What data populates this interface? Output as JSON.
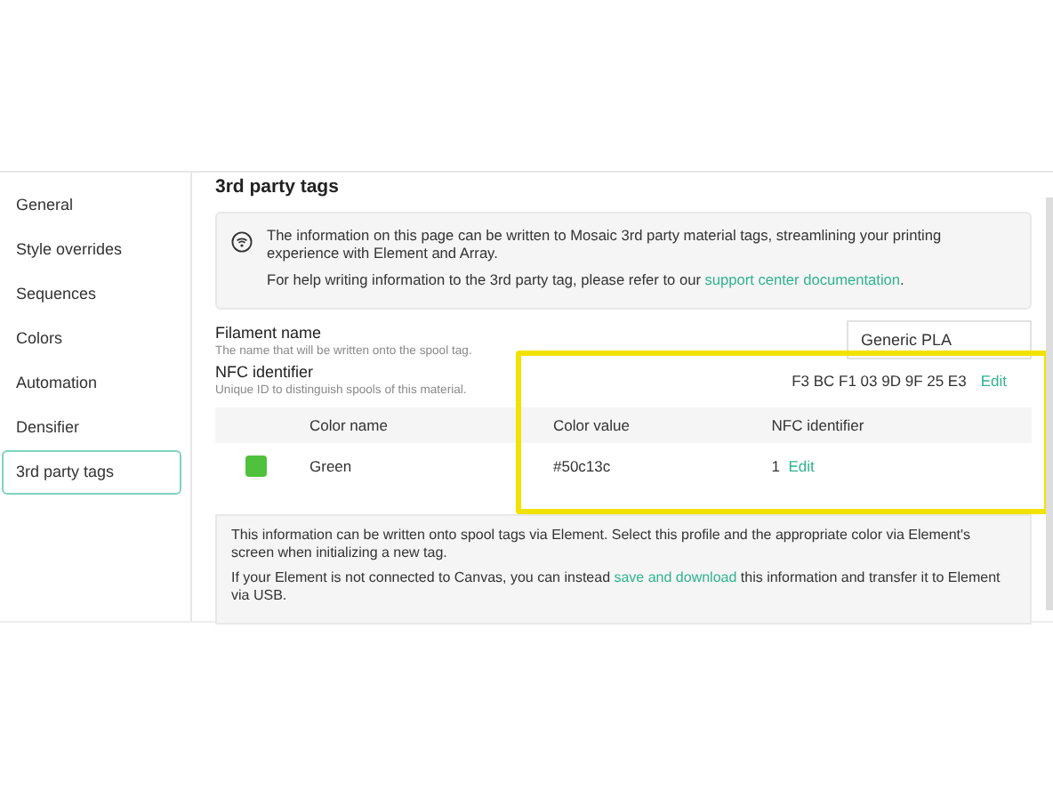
{
  "sidebar": {
    "items": [
      {
        "label": "General",
        "selected": false
      },
      {
        "label": "Style overrides",
        "selected": false
      },
      {
        "label": "Sequences",
        "selected": false
      },
      {
        "label": "Colors",
        "selected": false
      },
      {
        "label": "Automation",
        "selected": false
      },
      {
        "label": "Densifier",
        "selected": false
      },
      {
        "label": "3rd party tags",
        "selected": true
      }
    ]
  },
  "page": {
    "title": "3rd party tags",
    "info": {
      "text": "The information on this page can be written to Mosaic 3rd party material tags, streamlining your printing experience with Element and Array.",
      "help_before": "For help writing information to the 3rd party tag, please refer to our ",
      "help_link": "support center documentation",
      "help_after": "."
    },
    "filament_name": {
      "label": "Filament name",
      "hint": "The name that will be written onto the spool tag.",
      "value": "Generic PLA"
    },
    "nfc_identifier": {
      "label": "NFC identifier",
      "hint": "Unique ID to distinguish spools of this material.",
      "value": "F3 BC F1 03 9D 9F 25 E3",
      "action": "Edit"
    },
    "table": {
      "columns": [
        "Color name",
        "Color value",
        "NFC identifier"
      ],
      "rows": [
        {
          "color": "#50c13c",
          "name": "Green",
          "value": "#50c13c",
          "nfc": "1",
          "action": "Edit"
        }
      ]
    },
    "note": {
      "line1": "This information can be written onto spool tags via Element. Select this profile and the appropriate color via Element's screen when initializing a new tag.",
      "before": "If your Element is not connected to Canvas, you can instead ",
      "link": "save and download",
      "after": " this information and transfer it to Element via USB."
    }
  }
}
